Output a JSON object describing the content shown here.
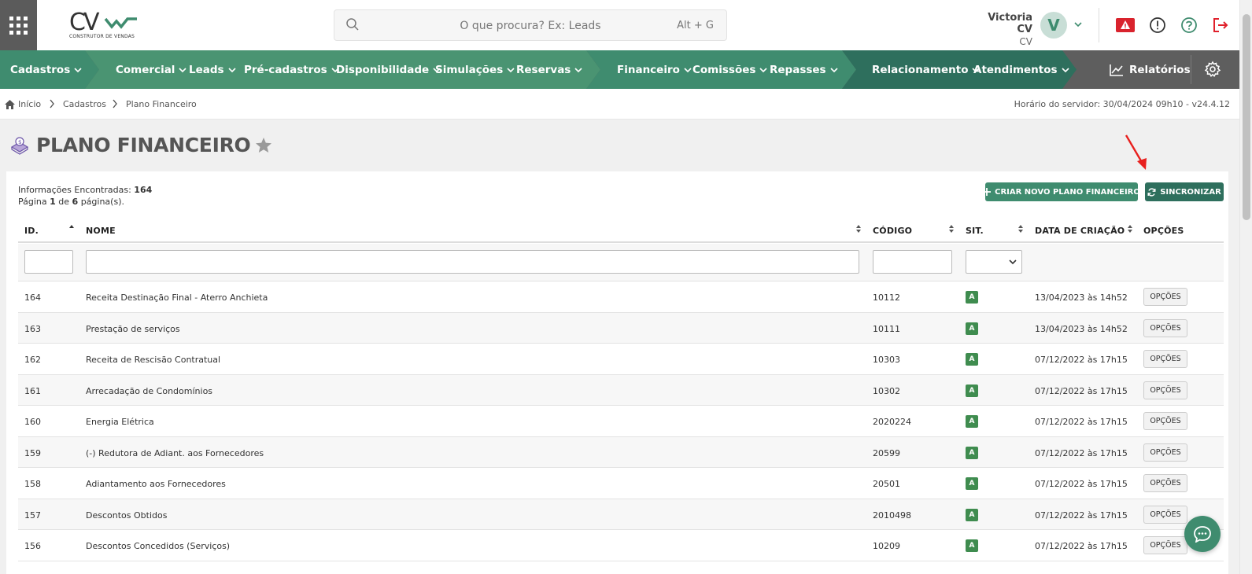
{
  "header": {
    "logo_text": "CONSTRUTOR DE VENDAS",
    "search_placeholder": "O que procura? Ex: Leads",
    "search_shortcut": "Alt + G",
    "user_name": "Victoria CV",
    "user_sub": "CV",
    "avatar_letter": "V"
  },
  "nav": {
    "items": [
      "Cadastros",
      "Comercial",
      "Leads",
      "Pré-cadastros",
      "Disponibilidade",
      "Simulações",
      "Reservas",
      "Financeiro",
      "Comissões",
      "Repasses",
      "Relacionamento",
      "Atendimentos"
    ],
    "reports": "Relatórios"
  },
  "breadcrumb": {
    "home": "Início",
    "level1": "Cadastros",
    "level2": "Plano Financeiro"
  },
  "server_time": "Horário do servidor: 30/04/2024 09h10 - v24.4.12",
  "page_title": "PLANO FINANCEIRO",
  "info": {
    "found_label": "Informações Encontradas:",
    "found_count": "164",
    "page_word": "Página",
    "page_current": "1",
    "page_of": "de",
    "page_total": "6",
    "page_suffix": "página(s)."
  },
  "buttons": {
    "create": "CRIAR NOVO PLANO FINANCEIRO",
    "sync": "SINCRONIZAR"
  },
  "table": {
    "headers": {
      "id": "ID.",
      "name": "NOME",
      "code": "CÓDIGO",
      "status": "SIT.",
      "created": "DATA DE CRIAÇÃO",
      "options": "OPÇÕES"
    },
    "option_label": "OPÇÕES",
    "rows": [
      {
        "id": "164",
        "name": "Receita Destinação Final - Aterro Anchieta",
        "code": "10112",
        "status": "A",
        "created": "13/04/2023 às 14h52"
      },
      {
        "id": "163",
        "name": "Prestação de serviços",
        "code": "10111",
        "status": "A",
        "created": "13/04/2023 às 14h52"
      },
      {
        "id": "162",
        "name": "Receita de Rescisão Contratual",
        "code": "10303",
        "status": "A",
        "created": "07/12/2022 às 17h15"
      },
      {
        "id": "161",
        "name": "Arrecadação de Condomínios",
        "code": "10302",
        "status": "A",
        "created": "07/12/2022 às 17h15"
      },
      {
        "id": "160",
        "name": "Energia Elétrica",
        "code": "2020224",
        "status": "A",
        "created": "07/12/2022 às 17h15"
      },
      {
        "id": "159",
        "name": "(-) Redutora de Adiant. aos Fornecedores",
        "code": "20599",
        "status": "A",
        "created": "07/12/2022 às 17h15"
      },
      {
        "id": "158",
        "name": "Adiantamento aos Fornecedores",
        "code": "20501",
        "status": "A",
        "created": "07/12/2022 às 17h15"
      },
      {
        "id": "157",
        "name": "Descontos Obtidos",
        "code": "2010498",
        "status": "A",
        "created": "07/12/2022 às 17h15"
      },
      {
        "id": "156",
        "name": "Descontos Concedidos (Serviços)",
        "code": "10209",
        "status": "A",
        "created": "07/12/2022 às 17h15"
      }
    ]
  },
  "colors": {
    "green": "#3f8c6f",
    "green_dark": "#2e6f5d",
    "nav_gray": "#5e5e5e"
  }
}
